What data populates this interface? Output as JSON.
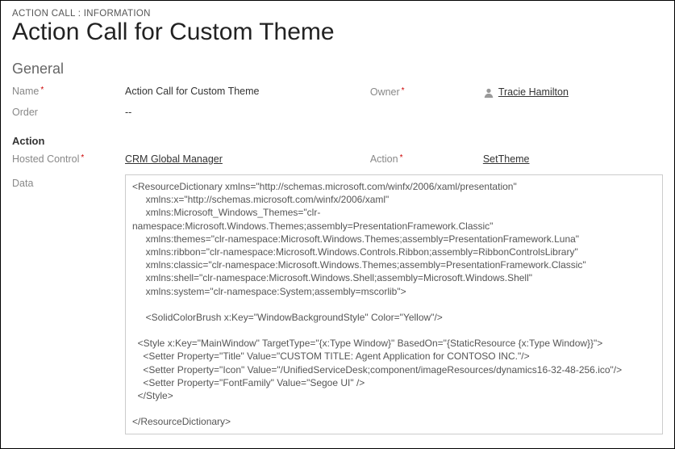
{
  "breadcrumb": {
    "entity": "ACTION CALL",
    "view": "INFORMATION"
  },
  "page_title": "Action Call for Custom Theme",
  "sections": {
    "general_label": "General",
    "action_label": "Action"
  },
  "fields": {
    "name": {
      "label": "Name",
      "required": true,
      "value": "Action Call for Custom Theme"
    },
    "owner": {
      "label": "Owner",
      "required": true,
      "value": "Tracie Hamilton"
    },
    "order": {
      "label": "Order",
      "required": false,
      "value": "--"
    },
    "hosted_control": {
      "label": "Hosted Control",
      "required": true,
      "value": "CRM Global Manager"
    },
    "action": {
      "label": "Action",
      "required": true,
      "value": "SetTheme"
    },
    "data": {
      "label": "Data",
      "required": false,
      "value": "<ResourceDictionary xmlns=\"http://schemas.microsoft.com/winfx/2006/xaml/presentation\"\n     xmlns:x=\"http://schemas.microsoft.com/winfx/2006/xaml\"\n     xmlns:Microsoft_Windows_Themes=\"clr-namespace:Microsoft.Windows.Themes;assembly=PresentationFramework.Classic\"\n     xmlns:themes=\"clr-namespace:Microsoft.Windows.Themes;assembly=PresentationFramework.Luna\"\n     xmlns:ribbon=\"clr-namespace:Microsoft.Windows.Controls.Ribbon;assembly=RibbonControlsLibrary\"\n     xmlns:classic=\"clr-namespace:Microsoft.Windows.Themes;assembly=PresentationFramework.Classic\"\n     xmlns:shell=\"clr-namespace:Microsoft.Windows.Shell;assembly=Microsoft.Windows.Shell\"\n     xmlns:system=\"clr-namespace:System;assembly=mscorlib\">\n\n     <SolidColorBrush x:Key=\"WindowBackgroundStyle\" Color=\"Yellow\"/>\n\n  <Style x:Key=\"MainWindow\" TargetType=\"{x:Type Window}\" BasedOn=\"{StaticResource {x:Type Window}}\">\n    <Setter Property=\"Title\" Value=\"CUSTOM TITLE: Agent Application for CONTOSO INC.\"/>\n    <Setter Property=\"Icon\" Value=\"/UnifiedServiceDesk;component/imageResources/dynamics16-32-48-256.ico\"/>\n    <Setter Property=\"FontFamily\" Value=\"Segoe UI\" />\n  </Style>\n\n</ResourceDictionary>"
    }
  }
}
